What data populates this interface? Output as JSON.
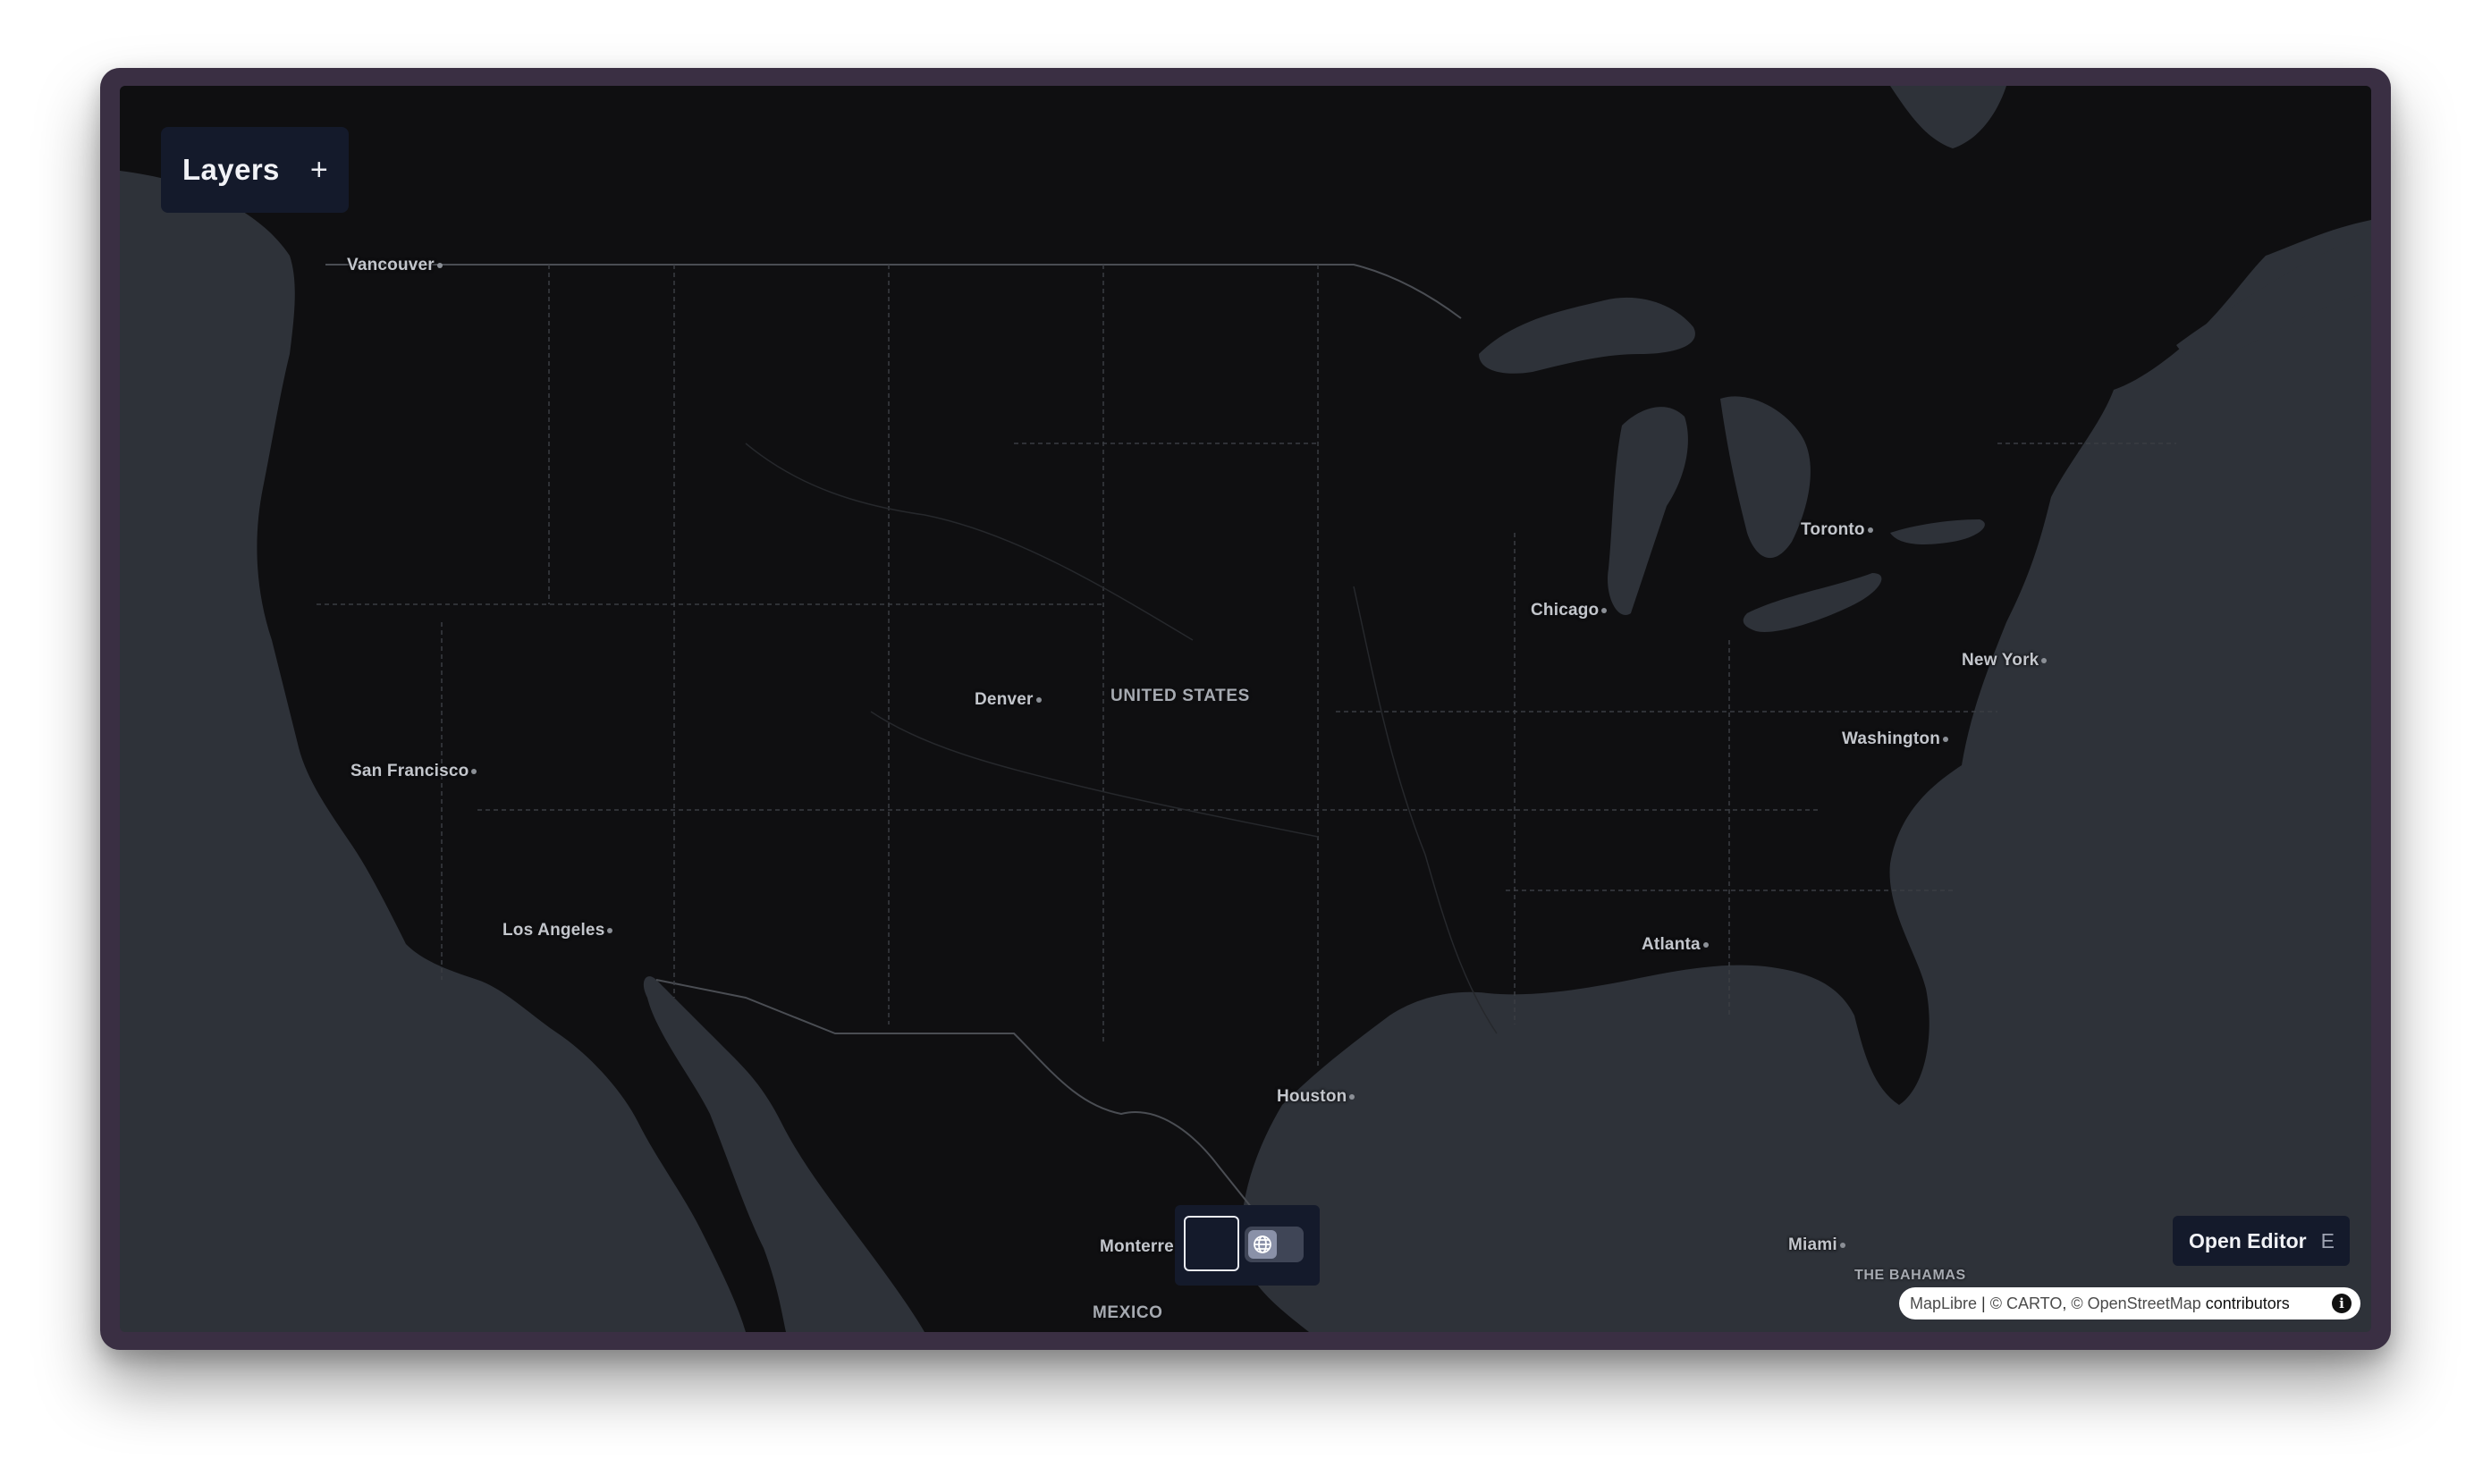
{
  "layers_panel": {
    "title": "Layers",
    "add_icon": "+"
  },
  "map": {
    "cities": [
      {
        "name": "Vancouver"
      },
      {
        "name": "San Francisco"
      },
      {
        "name": "Los Angeles"
      },
      {
        "name": "Denver"
      },
      {
        "name": "Chicago"
      },
      {
        "name": "Toronto"
      },
      {
        "name": "New York"
      },
      {
        "name": "Washington"
      },
      {
        "name": "Atlanta"
      },
      {
        "name": "Houston"
      },
      {
        "name": "Monterre"
      },
      {
        "name": "Miami"
      }
    ],
    "countries": [
      "UNITED STATES",
      "MEXICO",
      "THE BAHAMAS"
    ],
    "colors": {
      "land": "#0f0f11",
      "water": "#2e3239",
      "borders": "#4a4d53"
    }
  },
  "projection_toggle": {
    "options": [
      "flat",
      "globe"
    ],
    "icons": [
      "map-icon",
      "globe-icon"
    ]
  },
  "editor": {
    "label": "Open Editor",
    "shortcut": "E"
  },
  "attribution": {
    "maplibre": "MapLibre",
    "separator": " | ",
    "carto": "© CARTO",
    "comma": ", ",
    "osm": "© OpenStreetMap",
    "contributors": " contributors",
    "info_icon": "i"
  }
}
